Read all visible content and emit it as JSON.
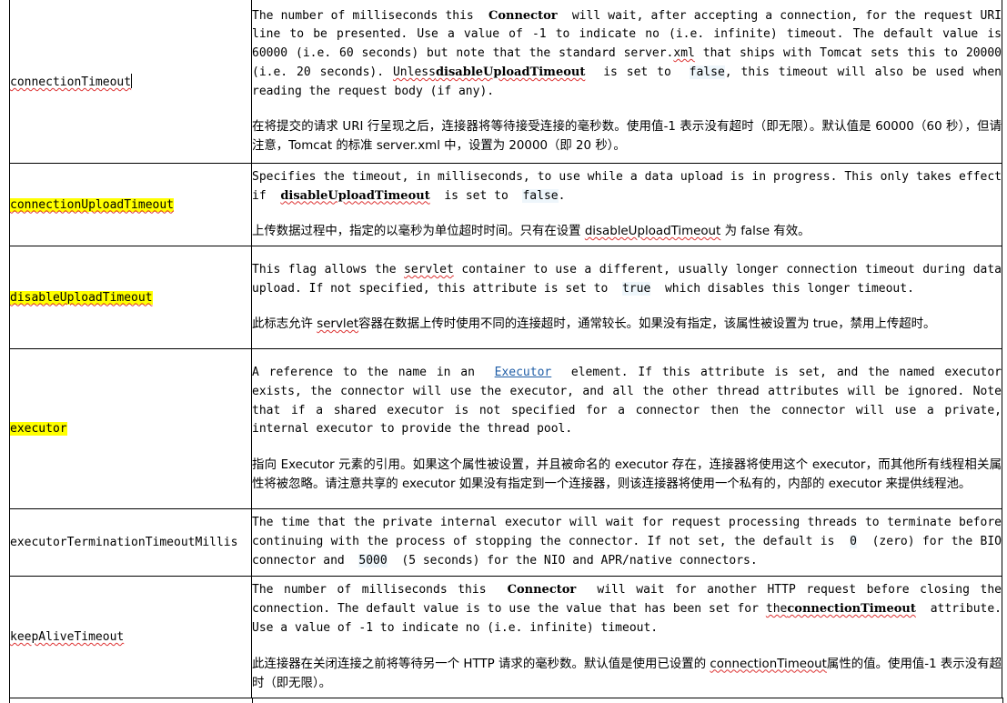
{
  "rows": [
    {
      "name": "connectionTimeout",
      "en": {
        "p1": "The number of milliseconds this",
        "p2": "Connector",
        "p3": "will wait, after accepting a connection, for the request URI line to be presented. Use a value of -1 to indicate no (i.e. infinite) timeout. The default value is 60000 (i.e. 60 seconds) but note that the standard server.",
        "p4": "xml",
        "p5": "that ships with Tomcat sets this to 20000 (i.e. 20 seconds).",
        "p6": "Unless",
        "p7": "disableUploadTimeout",
        "p8": "is set to",
        "p9": "false",
        "p10": ", this timeout will also be used when reading the request body (if any)."
      },
      "zh": "在将提交的请求 URI 行呈现之后，连接器将等待接受连接的毫秒数。使用值-1 表示没有超时（即无限）。默认值是 60000（60 秒），但请注意，Tomcat 的标准 server.xml 中，设置为 20000（即 20 秒）。"
    },
    {
      "name": "connectionUploadTimeout",
      "en": {
        "p1": "Specifies the timeout, in milliseconds, to use while a data upload is in progress. This only takes effect if",
        "p2": "disableUploadTimeout",
        "p3": "is set to",
        "p4": "false",
        "p5": "."
      },
      "zh": {
        "p1": "上传数据过程中，指定的以毫秒为单位超时时间。只有在设置",
        "p2": "disableUploadTimeout",
        "p3": "为 false 有效。"
      }
    },
    {
      "name": "disableUploadTimeout",
      "en": {
        "p1": "This flag allows the",
        "p2": "servlet",
        "p3": "container to use a different, usually longer connection timeout during data upload. If not specified, this attribute is set to",
        "p4": "true",
        "p5": "which disables this longer timeout."
      },
      "zh": {
        "p1": "此标志允许",
        "p2": "servlet",
        "p3": "容器在数据上传时使用不同的连接超时，通常较长。如果没有指定，该属性被设置为 true，禁用上传超时。"
      }
    },
    {
      "name": "executor",
      "en": {
        "p1": "A reference to the name in an",
        "p2": "Executor",
        "p3": "element. If this attribute is set, and the named executor exists, the connector will use the executor, and all the other thread attributes will be ignored. Note that if a shared executor is not specified for a connector then the connector will use a private, internal executor to provide the thread pool."
      },
      "zh": "指向 Executor 元素的引用。如果这个属性被设置，并且被命名的 executor 存在，连接器将使用这个 executor，而其他所有线程相关属性将被忽略。请注意共享的 executor 如果没有指定到一个连接器，则该连接器将使用一个私有的，内部的 executor 来提供线程池。"
    },
    {
      "name": "executorTerminationTimeoutMillis",
      "en": {
        "p1": "The time that the private internal executor will wait for request processing threads to terminate before continuing with the process of stopping the connector. If not set, the default is",
        "p2": "0",
        "p3": "(zero) for the BIO connector and",
        "p4": "5000",
        "p5": "(5 seconds) for the NIO and APR/native connectors."
      }
    },
    {
      "name": "keepAliveTimeout",
      "en": {
        "p1": "The number of milliseconds this",
        "p2": "Connector",
        "p3": "will wait for another HTTP request before closing the connection. The default value is to use the value that has been set for",
        "p4": "the",
        "p5": "connectionTimeout",
        "p6": "attribute. Use a value of -1 to indicate no (i.e. infinite) timeout."
      },
      "zh": {
        "p1": "此连接器在关闭连接之前将等待另一个 HTTP 请求的毫秒数。默认值是使用已设置的",
        "p2": "connectionTimeout",
        "p3": "属性的值。使用值-1 表示没有超时（即无限）。"
      }
    }
  ],
  "colors": {
    "highlight": "#ffff00",
    "link": "#1f5da6",
    "spellcheck": "#dd3333",
    "code_bg": "#eef6fb"
  }
}
